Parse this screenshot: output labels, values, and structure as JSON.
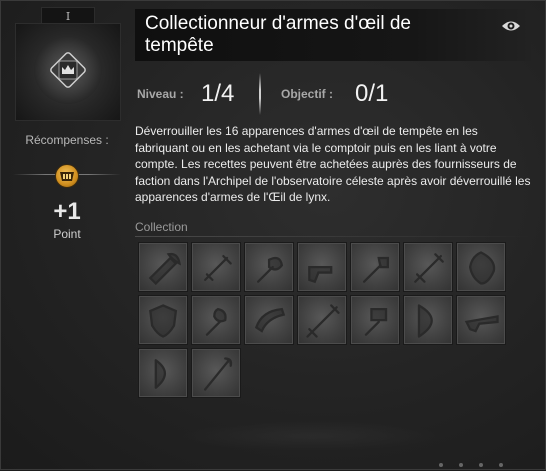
{
  "achievement": {
    "tier": "I",
    "title": "Collectionneur d'armes d'œil de tempête",
    "level_label": "Niveau :",
    "level_value": "1/4",
    "objective_label": "Objectif :",
    "objective_value": "0/1",
    "description": "Déverrouiller les 16 apparences d'armes d'œil de tempête en les fabriquant ou en les achetant via le comptoir puis en les liant à votre compte. Les recettes peuvent être achetées auprès des fournisseurs de faction dans l'Archipel de l'observatoire céleste après avoir déverrouillé les apparences d'armes de l'Œil de lynx.",
    "collection_label": "Collection"
  },
  "rewards": {
    "label": "Récompenses :",
    "value": "+1",
    "unit": "Point",
    "icon": "achievement-point-icon"
  },
  "collection": {
    "slots": [
      {
        "icon": "weapon-axe-icon",
        "locked": true
      },
      {
        "icon": "weapon-dagger-icon",
        "locked": true
      },
      {
        "icon": "weapon-mace-icon",
        "locked": true
      },
      {
        "icon": "weapon-pistol-icon",
        "locked": true
      },
      {
        "icon": "weapon-scepter-icon",
        "locked": true
      },
      {
        "icon": "weapon-sword-icon",
        "locked": true
      },
      {
        "icon": "weapon-focus-icon",
        "locked": true
      },
      {
        "icon": "weapon-shield-icon",
        "locked": true
      },
      {
        "icon": "weapon-torch-icon",
        "locked": true
      },
      {
        "icon": "weapon-warhorn-icon",
        "locked": true
      },
      {
        "icon": "weapon-greatsword-icon",
        "locked": true
      },
      {
        "icon": "weapon-hammer-icon",
        "locked": true
      },
      {
        "icon": "weapon-longbow-icon",
        "locked": true
      },
      {
        "icon": "weapon-rifle-icon",
        "locked": true
      },
      {
        "icon": "weapon-shortbow-icon",
        "locked": true
      },
      {
        "icon": "weapon-staff-icon",
        "locked": true
      }
    ]
  },
  "colors": {
    "title": "#ffffff",
    "text": "#ececec",
    "label": "#a8a8a8",
    "reward_gold": "#d08e1e",
    "slot_bg": "#424242"
  }
}
